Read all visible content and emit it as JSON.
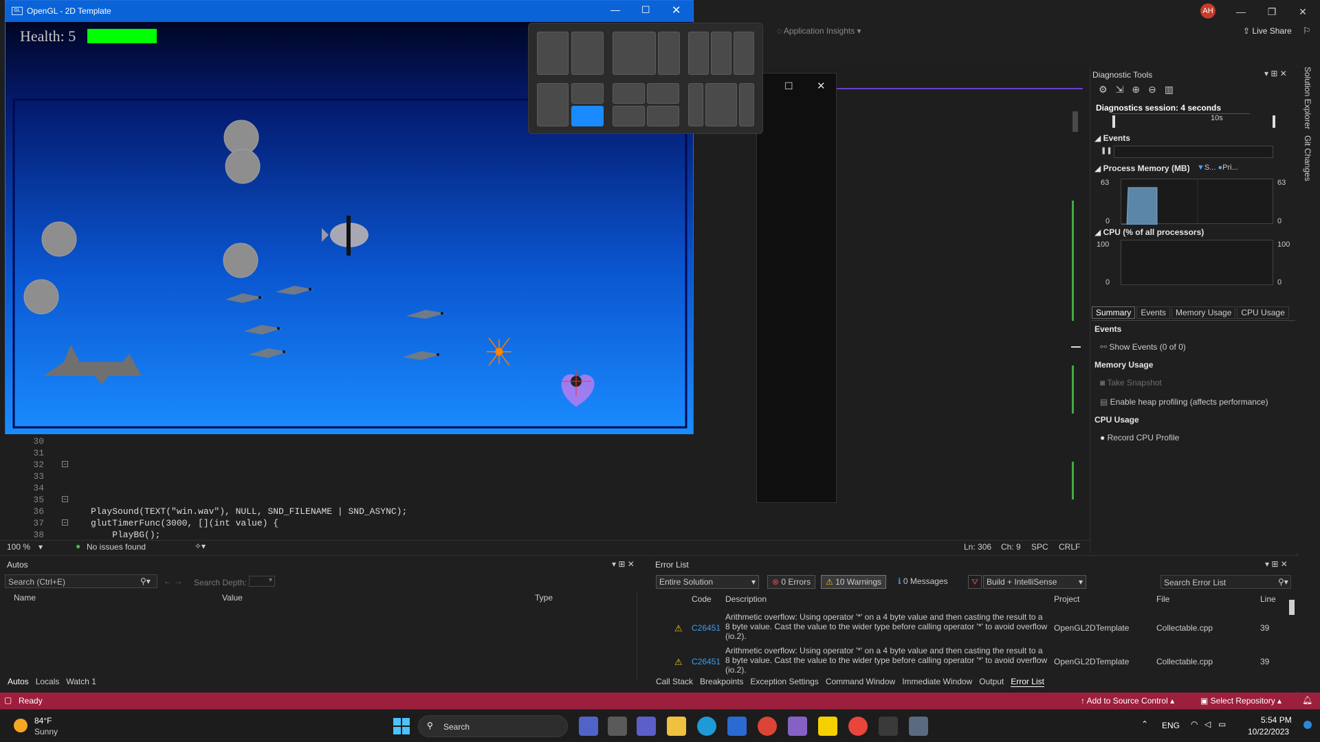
{
  "vs": {
    "user_initials": "AH",
    "app_insights": "Application Insights",
    "live_share": "Live Share",
    "side_tabs": [
      "Solution Explorer",
      "Git Changes"
    ]
  },
  "editor": {
    "lines": [
      {
        "n": "30",
        "code": ""
      },
      {
        "n": "31",
        "code": ""
      },
      {
        "n": "32",
        "code": ""
      },
      {
        "n": "33",
        "code": ""
      },
      {
        "n": "34",
        "code": ""
      },
      {
        "n": "35",
        "code": ""
      },
      {
        "n": "36",
        "code": "PlaySound(TEXT(\"win.wav\"), NULL, SND_FILENAME | SND_ASYNC);"
      },
      {
        "n": "37",
        "code": "glutTimerFunc(3000, [](int value) {"
      },
      {
        "n": "38",
        "code": "    PlayBG();"
      }
    ],
    "zoom": "100 %",
    "issues": "No issues found",
    "ln": "Ln: 306",
    "ch": "Ch: 9",
    "spc": "SPC",
    "crlf": "CRLF"
  },
  "gl_window": {
    "title": "OpenGL - 2D Template",
    "health_label": "Health: 5",
    "health_fraction": 1.0,
    "health_color": "#00ff00"
  },
  "diag": {
    "title": "Diagnostic Tools",
    "session": "Diagnostics session: 4 seconds",
    "timeline_tick": "10s",
    "events_label": "Events",
    "memory_label": "Process Memory (MB)",
    "memory_legend": [
      "S...",
      "Pri..."
    ],
    "mem_max": "63",
    "mem_min": "0",
    "cpu_label": "CPU (% of all processors)",
    "cpu_max": "100",
    "cpu_min": "0",
    "tabs": [
      "Summary",
      "Events",
      "Memory Usage",
      "CPU Usage"
    ],
    "sum_events": "Events",
    "show_events": "Show Events (0 of 0)",
    "sum_memory": "Memory Usage",
    "take_snapshot": "Take Snapshot",
    "heap_profiling": "Enable heap profiling (affects performance)",
    "sum_cpu": "CPU Usage",
    "record_cpu": "Record CPU Profile"
  },
  "autos": {
    "title": "Autos",
    "search_placeholder": "Search (Ctrl+E)",
    "search_depth": "Search Depth:",
    "cols": [
      "Name",
      "Value",
      "Type"
    ],
    "tabs": [
      "Autos",
      "Locals",
      "Watch 1"
    ]
  },
  "errors": {
    "title": "Error List",
    "scope": "Entire Solution",
    "errors_count": "0 Errors",
    "warnings_count": "10 Warnings",
    "messages_count": "0 Messages",
    "build_filter": "Build + IntelliSense",
    "search_placeholder": "Search Error List",
    "cols": [
      "Code",
      "Description",
      "Project",
      "File",
      "Line"
    ],
    "rows": [
      {
        "code": "C26451",
        "desc": "Arithmetic overflow: Using operator '*' on a 4 byte value and then casting the result to a 8 byte value. Cast the value to the wider type before calling operator '*' to avoid overflow (io.2).",
        "project": "OpenGL2DTemplate",
        "file": "Collectable.cpp",
        "line": "39"
      },
      {
        "code": "C26451",
        "desc": "Arithmetic overflow: Using operator '*' on a 4 byte value and then casting the result to a 8 byte value. Cast the value to the wider type before calling operator '*' to avoid overflow (io.2).",
        "project": "OpenGL2DTemplate",
        "file": "Collectable.cpp",
        "line": "39"
      }
    ],
    "tabs": [
      "Call Stack",
      "Breakpoints",
      "Exception Settings",
      "Command Window",
      "Immediate Window",
      "Output",
      "Error List"
    ]
  },
  "status": {
    "ready": "Ready",
    "add_source": "Add to Source Control",
    "select_repo": "Select Repository"
  },
  "taskbar": {
    "temp": "84°F",
    "weather": "Sunny",
    "search": "Search",
    "lang": "ENG",
    "time": "5:54 PM",
    "date": "10/22/2023"
  }
}
